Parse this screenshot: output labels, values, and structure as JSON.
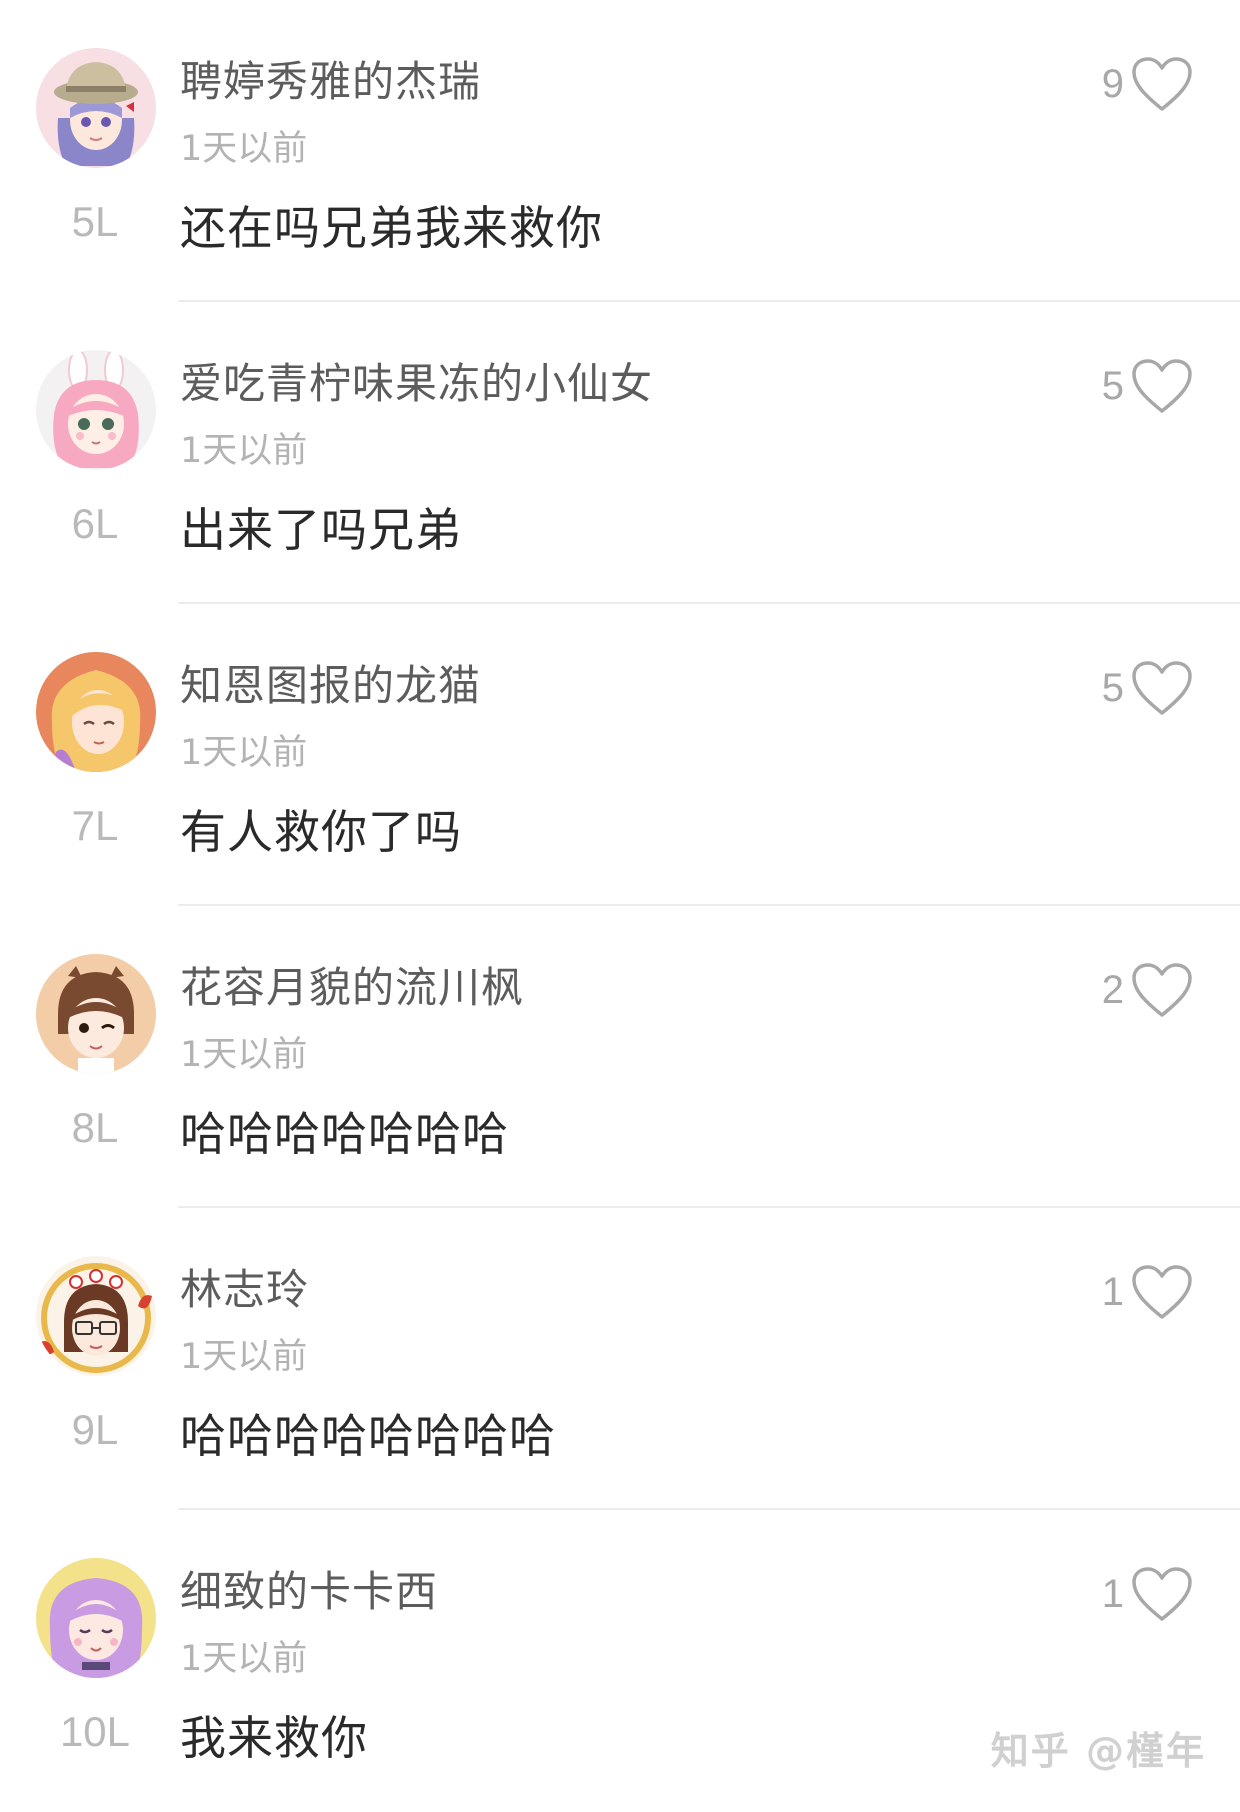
{
  "comments": [
    {
      "username": "聘婷秀雅的杰瑞",
      "time": "1天以前",
      "floor": "5L",
      "content": "还在吗兄弟我来救你",
      "likes": "9",
      "avatar": "girl-with-hat-avatar"
    },
    {
      "username": "爱吃青柠味果冻的小仙女",
      "time": "1天以前",
      "floor": "6L",
      "content": "出来了吗兄弟",
      "likes": "5",
      "avatar": "pink-bunny-girl-avatar"
    },
    {
      "username": "知恩图报的龙猫",
      "time": "1天以前",
      "floor": "7L",
      "content": "有人救你了吗",
      "likes": "5",
      "avatar": "blonde-girl-avatar"
    },
    {
      "username": "花容月貌的流川枫",
      "time": "1天以前",
      "floor": "8L",
      "content": "哈哈哈哈哈哈哈",
      "likes": "2",
      "avatar": "winking-girl-avatar"
    },
    {
      "username": "林志玲",
      "time": "1天以前",
      "floor": "9L",
      "content": "哈哈哈哈哈哈哈哈",
      "likes": "1",
      "avatar": "glasses-girl-avatar"
    },
    {
      "username": "细致的卡卡西",
      "time": "1天以前",
      "floor": "10L",
      "content": "我来救你",
      "likes": "1",
      "avatar": "purple-hair-girl-avatar"
    }
  ],
  "watermark": "知乎 @槿年",
  "colors": {
    "username": "#5c5c5c",
    "timestamp": "#b3b3b3",
    "content": "#2a2a2a",
    "floor": "#b9b9b9",
    "like": "#a8a8a8",
    "divider": "#ececec"
  }
}
